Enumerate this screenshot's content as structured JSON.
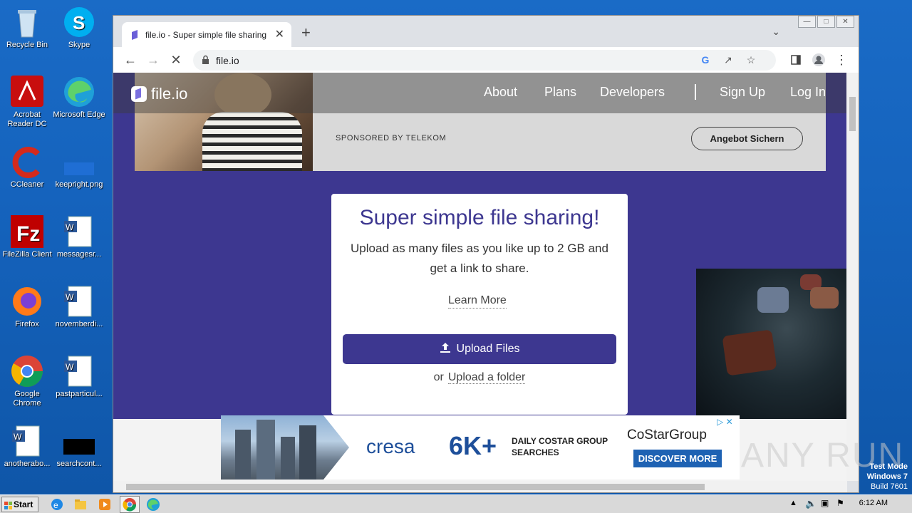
{
  "desktop": {
    "icons": [
      {
        "label": "Recycle Bin"
      },
      {
        "label": "Skype"
      },
      {
        "label": "Acrobat Reader DC"
      },
      {
        "label": "Microsoft Edge"
      },
      {
        "label": "CCleaner"
      },
      {
        "label": "keepright.png"
      },
      {
        "label": "FileZilla Client"
      },
      {
        "label": "messagesr..."
      },
      {
        "label": "Firefox"
      },
      {
        "label": "novemberdi..."
      },
      {
        "label": "Google Chrome"
      },
      {
        "label": "pastparticul..."
      },
      {
        "label": "anotherabo..."
      },
      {
        "label": "searchcont..."
      }
    ]
  },
  "browser": {
    "tab_title": "file.io - Super simple file sharing",
    "url": "file.io",
    "icons": {
      "back": "back-arrow-icon",
      "forward": "forward-arrow-icon",
      "stop": "stop-loading-icon"
    }
  },
  "site": {
    "logo": "file.io",
    "nav": {
      "about": "About",
      "plans": "Plans",
      "developers": "Developers",
      "signup": "Sign Up",
      "login": "Log In"
    },
    "ad_top": {
      "sponsored": "SPONSORED BY TELEKOM",
      "cta": "Angebot Sichern"
    },
    "hero": {
      "title": "Super simple file sharing!",
      "subtitle": "Upload as many files as you like up to 2 GB and get a link to share.",
      "learn_more": "Learn More",
      "upload_button": "Upload Files",
      "or": "or",
      "upload_folder": "Upload a folder"
    },
    "ad_bottom": {
      "brand": "cresa",
      "big": "6K+",
      "line1": "DAILY COSTAR GROUP",
      "line2": "SEARCHES",
      "costar": "CoStarGroup",
      "cta": "DISCOVER MORE"
    }
  },
  "watermark": "ANY RUN",
  "system": {
    "test_mode": "Test Mode",
    "os": "Windows 7",
    "build": "Build 7601",
    "start_label": "Start",
    "clock": "6:12 AM"
  }
}
